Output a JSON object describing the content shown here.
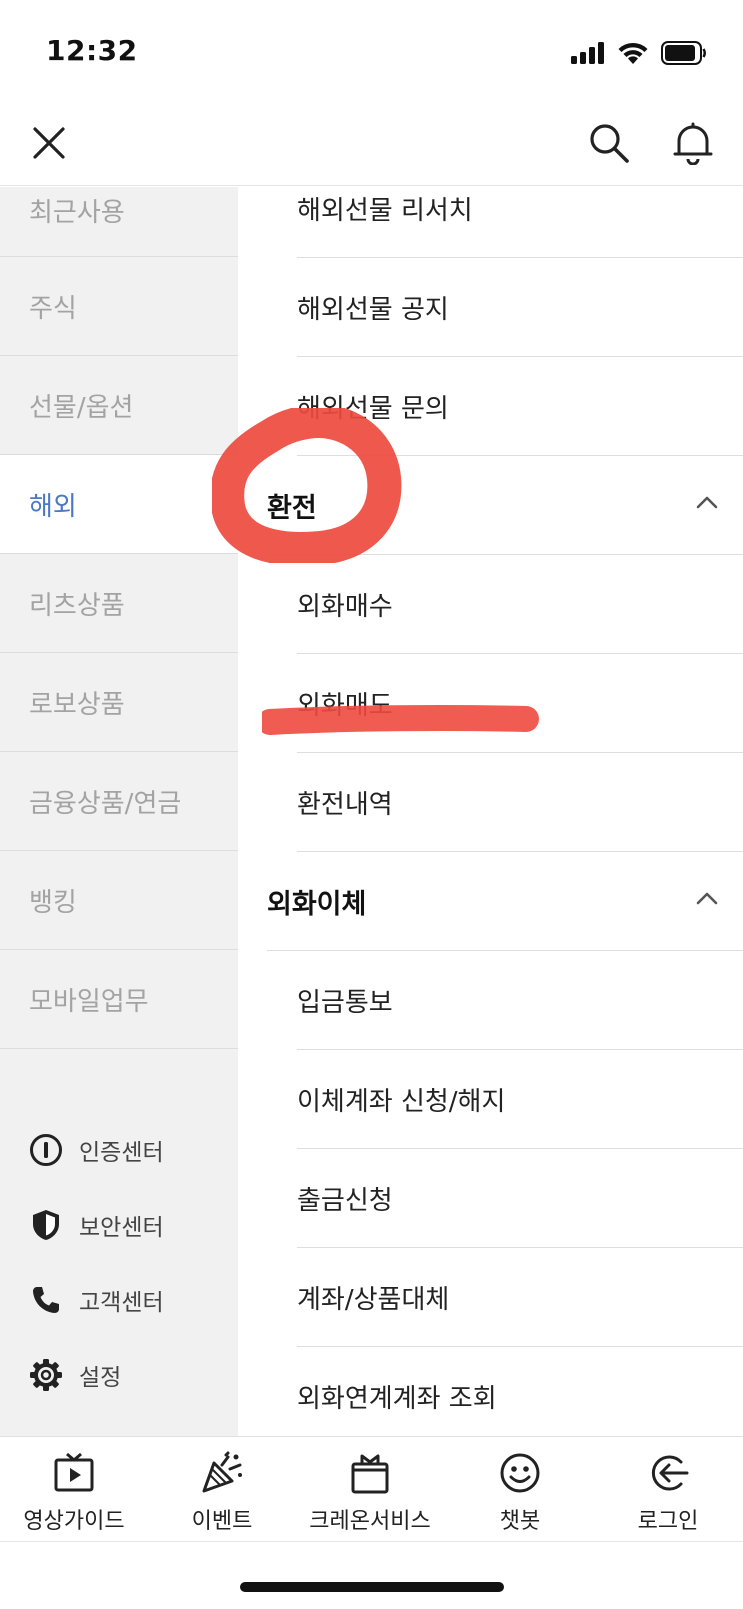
{
  "status_bar": {
    "time": "12:32"
  },
  "header": {
    "close_icon": "close-icon",
    "search_icon": "search-icon",
    "bell_icon": "bell-icon"
  },
  "sidebar": {
    "items": [
      {
        "label": "최근사용",
        "active": false
      },
      {
        "label": "주식",
        "active": false
      },
      {
        "label": "선물/옵션",
        "active": false
      },
      {
        "label": "해외",
        "active": true
      },
      {
        "label": "리츠상품",
        "active": false
      },
      {
        "label": "로보상품",
        "active": false
      },
      {
        "label": "금융상품/연금",
        "active": false
      },
      {
        "label": "뱅킹",
        "active": false
      },
      {
        "label": "모바일업무",
        "active": false
      }
    ],
    "utilities": [
      {
        "label": "인증센터",
        "icon": "info-icon"
      },
      {
        "label": "보안센터",
        "icon": "shield-icon"
      },
      {
        "label": "고객센터",
        "icon": "phone-icon"
      },
      {
        "label": "설정",
        "icon": "gear-icon"
      }
    ],
    "active_color": "#4a78c6"
  },
  "content": {
    "futures_items": [
      "해외선물 리서치",
      "해외선물 공지",
      "해외선물 문의"
    ],
    "groups": [
      {
        "title": "환전",
        "expanded": true,
        "items": [
          "외화매수",
          "외화매도",
          "환전내역"
        ]
      },
      {
        "title": "외화이체",
        "expanded": true,
        "items": [
          "입금통보",
          "이체계좌 신청/해지",
          "출금신청",
          "계좌/상품대체",
          "외화연계계좌 조회"
        ]
      }
    ]
  },
  "annotation_color": "#ee4a3e",
  "bottom_nav": [
    {
      "label": "영상가이드",
      "icon": "video-guide-icon"
    },
    {
      "label": "이벤트",
      "icon": "party-popper-icon"
    },
    {
      "label": "크레온서비스",
      "icon": "gift-box-icon"
    },
    {
      "label": "챗봇",
      "icon": "smiley-icon"
    },
    {
      "label": "로그인",
      "icon": "login-icon"
    }
  ]
}
